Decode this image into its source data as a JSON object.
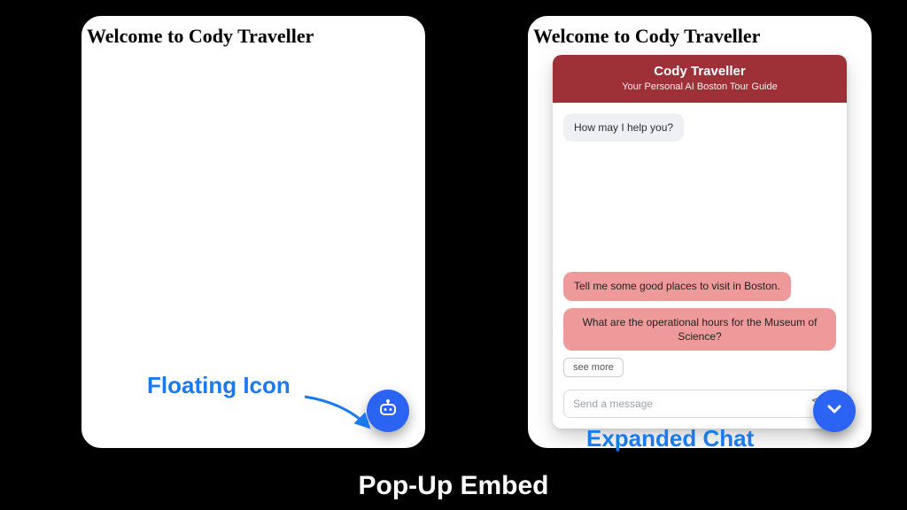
{
  "caption": "Pop-Up Embed",
  "annotations": {
    "floating_icon": "Floating Icon",
    "expanded_chat": "Expanded Chat"
  },
  "pages": {
    "left": {
      "title": "Welcome to Cody Traveller"
    },
    "right": {
      "title": "Welcome to Cody Traveller"
    }
  },
  "chat": {
    "header": {
      "title": "Cody Traveller",
      "subtitle": "Your Personal AI Boston Tour Guide"
    },
    "greeting": "How may I help you?",
    "suggestions": [
      "Tell me some good places to visit in Boston.",
      "What are the operational hours for the Museum of Science?"
    ],
    "see_more_label": "see more",
    "input_placeholder": "Send a message"
  },
  "colors": {
    "fab": "#2b63f3",
    "chat_header": "#9e3038",
    "suggestion": "#ef9a9a",
    "annotation": "#1b7af0"
  }
}
